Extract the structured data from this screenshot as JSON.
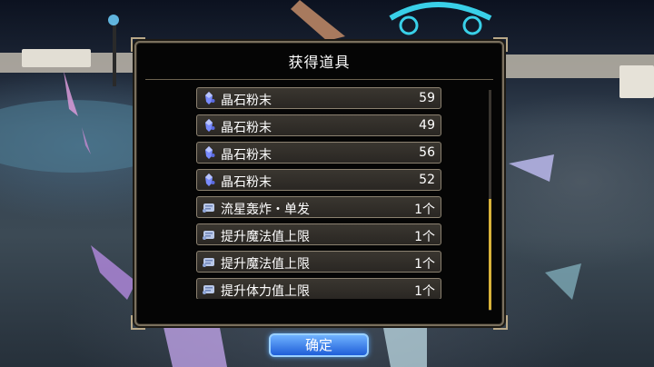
{
  "dialog": {
    "title": "获得道具",
    "items": [
      {
        "name": "晶石粉末",
        "qty": "59",
        "icon": "crystal-powder-icon"
      },
      {
        "name": "晶石粉末",
        "qty": "49",
        "icon": "crystal-powder-icon"
      },
      {
        "name": "晶石粉末",
        "qty": "56",
        "icon": "crystal-powder-icon"
      },
      {
        "name": "晶石粉末",
        "qty": "52",
        "icon": "crystal-powder-icon"
      },
      {
        "name": "流星轰炸・单发",
        "qty": "1个",
        "icon": "scroll-icon"
      },
      {
        "name": "提升魔法值上限",
        "qty": "1个",
        "icon": "scroll-icon"
      },
      {
        "name": "提升魔法值上限",
        "qty": "1个",
        "icon": "scroll-icon"
      },
      {
        "name": "提升体力值上限",
        "qty": "1个",
        "icon": "scroll-icon"
      }
    ],
    "scroll_position": 0.5,
    "confirm_label": "确定"
  },
  "colors": {
    "panel_border": "#7a705e",
    "row_border": "#8b8170",
    "scroll_thumb": "#d8b23a",
    "button_blue": "#1f5ed8"
  }
}
